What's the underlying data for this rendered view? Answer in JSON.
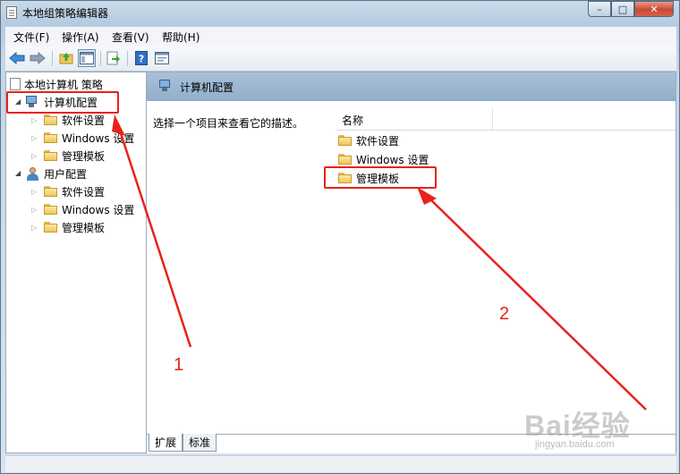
{
  "window": {
    "title": "本地组策略编辑器",
    "caption_min": "–",
    "caption_max": "□",
    "caption_close": "✕"
  },
  "menu": [
    "文件(F)",
    "操作(A)",
    "查看(V)",
    "帮助(H)"
  ],
  "toolbar": {
    "icons": [
      "back-arrow-icon",
      "forward-arrow-icon",
      "up-folder-icon",
      "show-hide-tree-icon",
      "export-list-icon",
      "help-icon",
      "properties-icon"
    ]
  },
  "tree": {
    "root": "本地计算机 策略",
    "computer_config": "计算机配置",
    "computer_children": [
      "软件设置",
      "Windows 设置",
      "管理模板"
    ],
    "user_config": "用户配置",
    "user_children": [
      "软件设置",
      "Windows 设置",
      "管理模板"
    ]
  },
  "details": {
    "header": "计算机配置",
    "description": "选择一个项目来查看它的描述。",
    "column_name": "名称",
    "items": [
      "软件设置",
      "Windows 设置",
      "管理模板"
    ]
  },
  "tabs": [
    "扩展",
    "标准"
  ],
  "annotations": {
    "label1": "1",
    "label2": "2",
    "color": "#e8221b"
  },
  "watermark": {
    "text": "Bai经验",
    "sub": "jingyan.baidu.com"
  }
}
